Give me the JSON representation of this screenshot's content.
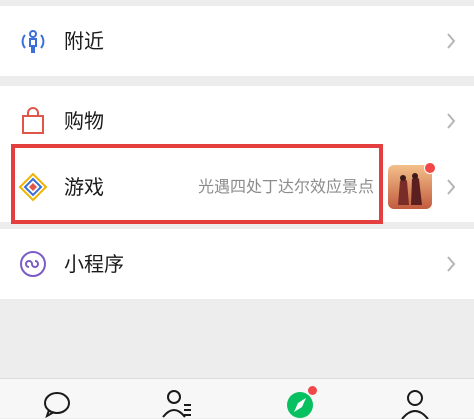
{
  "menu": {
    "nearby": {
      "label": "附近",
      "icon": "nearby-person-icon"
    },
    "shopping": {
      "label": "购物",
      "icon": "shopping-bag-icon"
    },
    "games": {
      "label": "游戏",
      "subtitle": "光遇四处丁达尔效应景点",
      "icon": "game-diamond-icon",
      "thumbnail": "game-thumbnail",
      "has_badge": true
    },
    "mini_programs": {
      "label": "小程序",
      "icon": "mini-program-icon"
    }
  },
  "tabbar": {
    "items": [
      {
        "icon": "chat-bubble-icon"
      },
      {
        "icon": "contacts-icon"
      },
      {
        "icon": "discover-compass-icon",
        "active": true,
        "has_badge": true
      },
      {
        "icon": "me-person-icon"
      }
    ]
  },
  "colors": {
    "accent_green": "#07c160",
    "highlight_red": "#e53e3e",
    "badge_red": "#f04848",
    "icon_blue": "#3a6fd8"
  }
}
